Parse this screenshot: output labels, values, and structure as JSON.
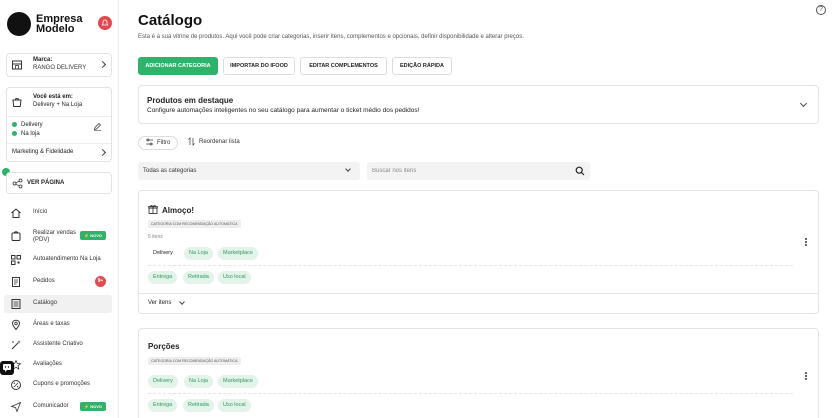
{
  "brand": {
    "name_line1": "Empresa",
    "name_line2": "Modelo"
  },
  "marca": {
    "label": "Marca:",
    "value": "RANGO DELIVERY"
  },
  "status": {
    "title": "Você está em:",
    "value": "Delivery + Na Loja",
    "channels": [
      "Delivery",
      "Na loja"
    ],
    "marketing": "Marketing & Fidelidade"
  },
  "ver_pagina": "VER PÁGINA",
  "nav": [
    {
      "label": "Início",
      "icon": "home-icon"
    },
    {
      "label": "Realizar vendas (PDV)",
      "icon": "bag-icon",
      "badge": "NOVO"
    },
    {
      "label": "Autoatendimento Na Loja",
      "icon": "qrcode-icon"
    },
    {
      "label": "Pedidos",
      "icon": "receipt-icon",
      "count": "9+"
    },
    {
      "label": "Catálogo",
      "icon": "menu-book-icon",
      "active": true
    },
    {
      "label": "Áreas e taxas",
      "icon": "location-icon"
    },
    {
      "label": "Assistente Criativo",
      "icon": "magic-wand-icon"
    },
    {
      "label": "Avaliações",
      "icon": "star-icon"
    },
    {
      "label": "Cupons e promoções",
      "icon": "discount-icon"
    },
    {
      "label": "Comunicador",
      "icon": "send-icon",
      "badge": "NOVO"
    }
  ],
  "header": {
    "title": "Catálogo",
    "subtitle": "Esta é a sua vitrine de produtos. Aqui você pode criar categorias, inserir itens, complementos e opcionais, definir disponibilidade e alterar preços."
  },
  "actions": {
    "add_category": "ADICIONAR CATEGORIA",
    "import_ifood": "IMPORTAR DO IFOOD",
    "edit_complements": "EDITAR COMPLEMENTOS",
    "quick_edit": "EDIÇÃO RÁPIDA"
  },
  "featured": {
    "title": "Produtos em destaque",
    "description": "Configure automações inteligentes no seu catálogo para aumentar o ticket médio dos pedidos!"
  },
  "toolbar": {
    "filter": "Filtro",
    "reorder": "Reordenar lista"
  },
  "category_select": "Todas as categorias",
  "search": {
    "placeholder": "Buscar nos itens"
  },
  "categories": [
    {
      "name": "Almoço!",
      "tag": "CATEGORIA COM RECOMENDAÇÃO AUTOMÁTICA",
      "count": "5 itens",
      "channels": [
        "Delivery",
        "Na Loja",
        "Marketplace"
      ],
      "modes": [
        "Entrega",
        "Retirada",
        "Uso local"
      ],
      "footer": "Ver itens"
    },
    {
      "name": "Porções",
      "tag": "CATEGORIA COM RECOMENDAÇÃO AUTOMÁTICA",
      "channels": [
        "Delivery",
        "Na Loja",
        "Marketplace"
      ],
      "modes": [
        "Entrega",
        "Retirada",
        "Uso local"
      ]
    }
  ],
  "colors": {
    "accent": "#2fb36b",
    "alert": "#e5484d"
  }
}
